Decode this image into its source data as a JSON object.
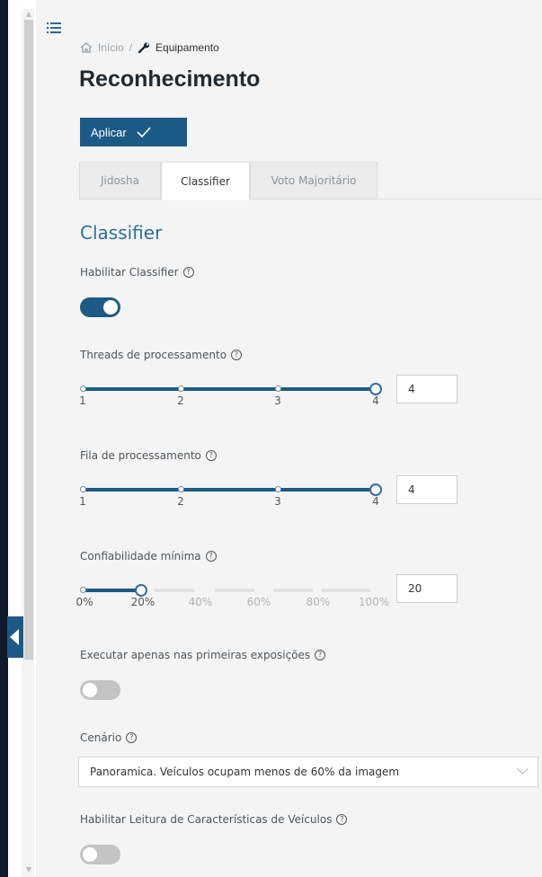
{
  "breadcrumb": {
    "home": "Início",
    "separator": "/",
    "current": "Equipamento"
  },
  "page": {
    "title": "Reconhecimento"
  },
  "toolbar": {
    "apply_label": "Aplicar"
  },
  "tabs": [
    {
      "label": "Jidosha",
      "active": false
    },
    {
      "label": "Classifier",
      "active": true
    },
    {
      "label": "Voto Majoritário",
      "active": false
    }
  ],
  "section": {
    "title": "Classifier"
  },
  "fields": {
    "enable_classifier": {
      "label": "Habilitar Classifier",
      "value": true
    },
    "threads": {
      "label": "Threads de processamento",
      "ticks": [
        "1",
        "2",
        "3",
        "4"
      ],
      "value": "4"
    },
    "queue": {
      "label": "Fila de processamento",
      "ticks": [
        "1",
        "2",
        "3",
        "4"
      ],
      "value": "4"
    },
    "min_confidence": {
      "label": "Confiabilidade mínima",
      "ticks": [
        "0%",
        "20%",
        "40%",
        "60%",
        "80%",
        "100%"
      ],
      "value": "20"
    },
    "first_exposures": {
      "label": "Executar apenas nas primeiras exposições",
      "value": false
    },
    "scenario": {
      "label": "Cenário",
      "value": "Panoramica. Veículos ocupam menos de 60% da imagem"
    },
    "vehicle_features": {
      "label": "Habilitar Leitura de Características de Veículos",
      "value": false
    }
  },
  "colors": {
    "primary": "#1c5a86",
    "section_title": "#2f6f98",
    "background": "#f4f4f4",
    "sidebar": "#101a2b"
  }
}
